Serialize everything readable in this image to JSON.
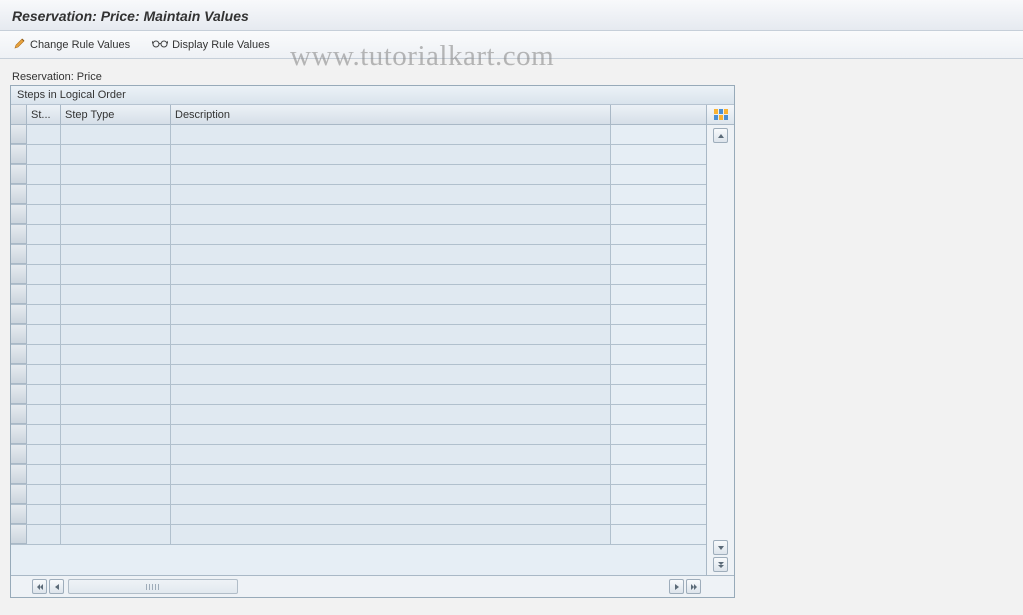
{
  "header": {
    "title": "Reservation: Price: Maintain Values"
  },
  "toolbar": {
    "change_label": "Change Rule Values",
    "display_label": "Display Rule Values"
  },
  "section": {
    "label": "Reservation: Price"
  },
  "grid": {
    "title": "Steps in Logical Order",
    "columns": {
      "st": "St...",
      "step_type": "Step Type",
      "description": "Description"
    },
    "rows": [
      {
        "st": "",
        "step_type": "",
        "description": ""
      },
      {
        "st": "",
        "step_type": "",
        "description": ""
      },
      {
        "st": "",
        "step_type": "",
        "description": ""
      },
      {
        "st": "",
        "step_type": "",
        "description": ""
      },
      {
        "st": "",
        "step_type": "",
        "description": ""
      },
      {
        "st": "",
        "step_type": "",
        "description": ""
      },
      {
        "st": "",
        "step_type": "",
        "description": ""
      },
      {
        "st": "",
        "step_type": "",
        "description": ""
      },
      {
        "st": "",
        "step_type": "",
        "description": ""
      },
      {
        "st": "",
        "step_type": "",
        "description": ""
      },
      {
        "st": "",
        "step_type": "",
        "description": ""
      },
      {
        "st": "",
        "step_type": "",
        "description": ""
      },
      {
        "st": "",
        "step_type": "",
        "description": ""
      },
      {
        "st": "",
        "step_type": "",
        "description": ""
      },
      {
        "st": "",
        "step_type": "",
        "description": ""
      },
      {
        "st": "",
        "step_type": "",
        "description": ""
      },
      {
        "st": "",
        "step_type": "",
        "description": ""
      },
      {
        "st": "",
        "step_type": "",
        "description": ""
      },
      {
        "st": "",
        "step_type": "",
        "description": ""
      },
      {
        "st": "",
        "step_type": "",
        "description": ""
      },
      {
        "st": "",
        "step_type": "",
        "description": ""
      }
    ]
  },
  "watermark": "www.tutorialkart.com"
}
